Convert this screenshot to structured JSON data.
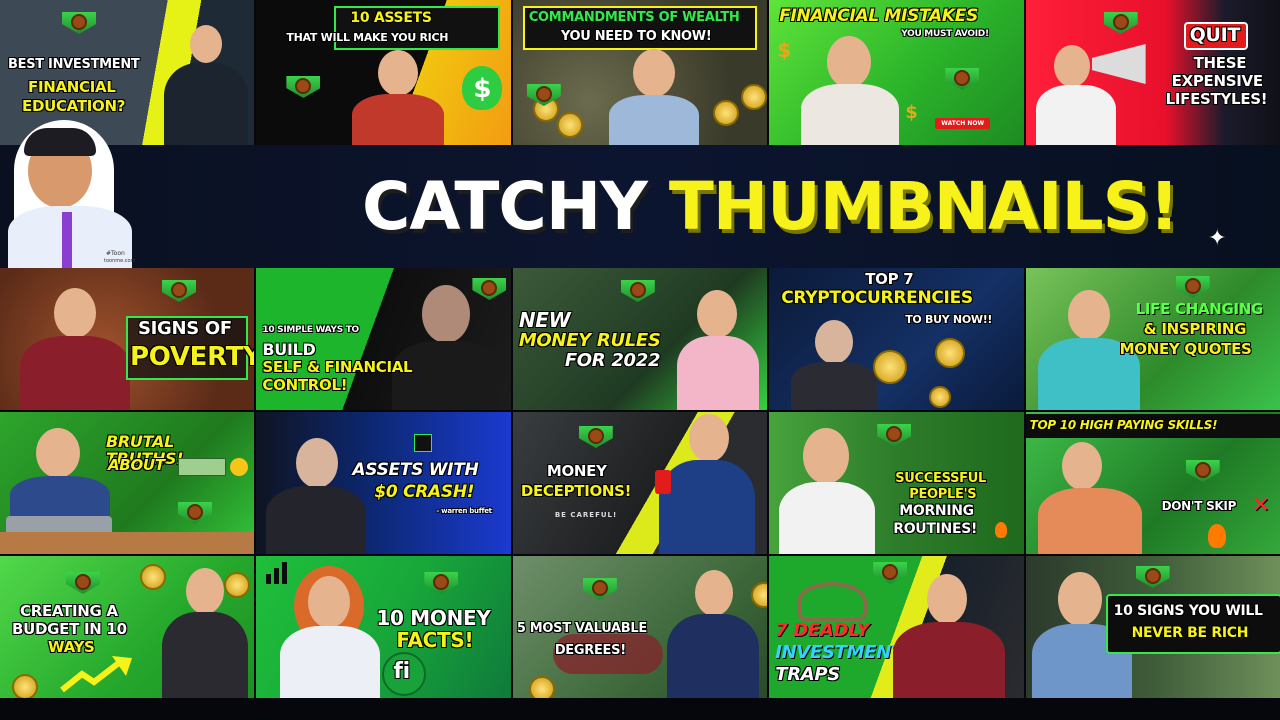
{
  "hero": {
    "title_white": "CATCHY",
    "title_yellow": "THUMBNAILS!",
    "avatar_caption_1": "#Toon",
    "avatar_caption_2": "toonme.com"
  },
  "colors": {
    "accent_yellow": "#f7f31a",
    "accent_green": "#33e84a",
    "accent_red": "#ff2a2a",
    "background": "#05070d"
  },
  "row1": [
    {
      "lines": [
        "BEST INVESTMENT",
        "FINANCIAL",
        "EDUCATION?"
      ]
    },
    {
      "lines": [
        "10 ASSETS",
        "THAT WILL MAKE YOU RICH"
      ]
    },
    {
      "lines": [
        "COMMANDMENTS OF WEALTH",
        "YOU NEED TO KNOW!"
      ]
    },
    {
      "lines": [
        "FINANCIAL MISTAKES",
        "YOU MUST AVOID!"
      ],
      "button": "WATCH NOW"
    },
    {
      "lines": [
        "QUIT",
        "THESE",
        "EXPENSIVE",
        "LIFESTYLES!"
      ]
    }
  ],
  "row3": [
    {
      "lines": [
        "SIGNS OF",
        "POVERTY"
      ]
    },
    {
      "lines": [
        "10 SIMPLE WAYS TO",
        "BUILD",
        "SELF & FINANCIAL",
        "CONTROL!"
      ]
    },
    {
      "lines": [
        "NEW",
        "MONEY RULES",
        "FOR 2022"
      ]
    },
    {
      "lines": [
        "TOP 7",
        "CRYPTOCURRENCIES",
        "TO BUY NOW!!"
      ]
    },
    {
      "lines": [
        "LIFE CHANGING",
        "& INSPIRING",
        "MONEY QUOTES"
      ]
    }
  ],
  "row4": [
    {
      "lines": [
        "BRUTAL TRUTHS!",
        "ABOUT"
      ]
    },
    {
      "lines": [
        "ASSETS WITH",
        "$0 CRASH!",
        "- warren buffet"
      ]
    },
    {
      "lines": [
        "MONEY",
        "DECEPTIONS!",
        "BE CAREFUL!"
      ]
    },
    {
      "lines": [
        "SUCCESSFUL",
        "PEOPLE'S",
        "MORNING",
        "ROUTINES!"
      ]
    },
    {
      "lines": [
        "TOP 10 HIGH PAYING SKILLS!",
        "DON'T SKIP"
      ]
    }
  ],
  "row5": [
    {
      "lines": [
        "CREATING A",
        "BUDGET IN 10",
        "WAYS"
      ]
    },
    {
      "lines": [
        "10 MONEY",
        "FACTS!",
        "fi"
      ]
    },
    {
      "lines": [
        "5 MOST VALUABLE",
        "DEGREES!"
      ]
    },
    {
      "lines": [
        "7 DEADLY",
        "INVESTMENT",
        "TRAPS"
      ]
    },
    {
      "lines": [
        "10 SIGNS YOU WILL",
        "NEVER BE RICH"
      ]
    }
  ]
}
